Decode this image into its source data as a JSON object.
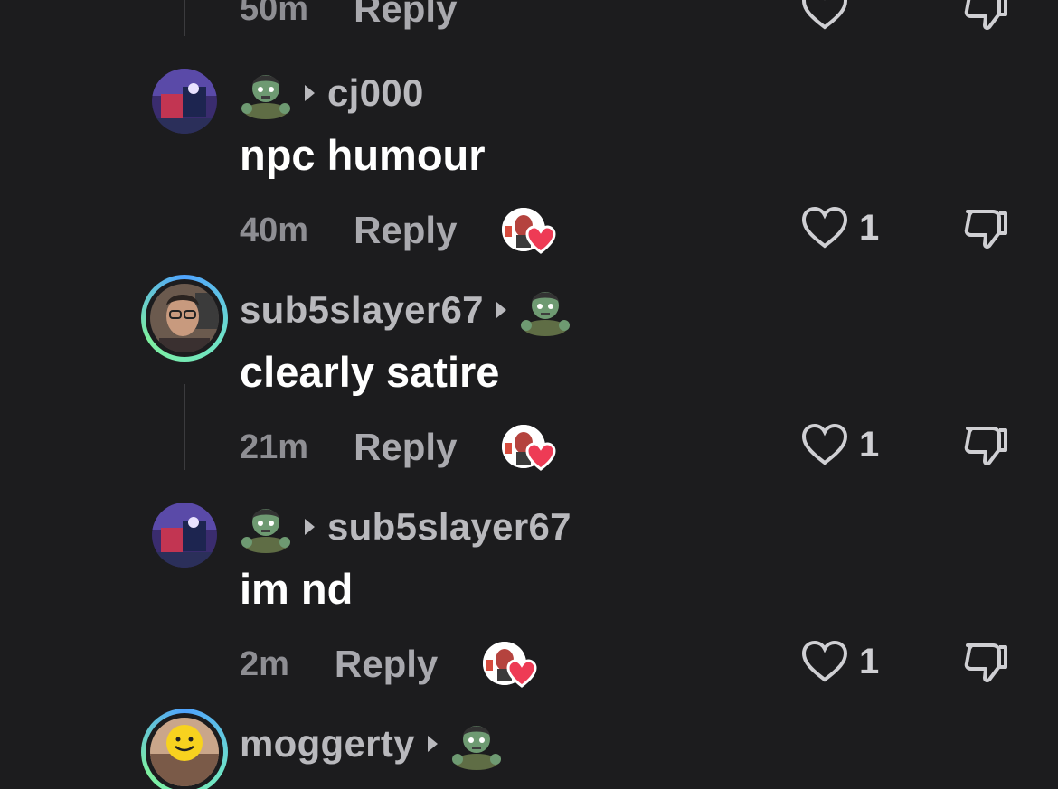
{
  "top": {
    "time": "50m",
    "reply": "Reply"
  },
  "comments": [
    {
      "username": "cj000",
      "reply_to": "cj000",
      "text": "npc humour",
      "time": "40m",
      "reply": "Reply",
      "likes": "1"
    },
    {
      "username": "sub5slayer67",
      "text": "clearly satire",
      "time": "21m",
      "reply": "Reply",
      "likes": "1"
    },
    {
      "reply_to": "sub5slayer67",
      "text": "im nd",
      "time": "2m",
      "reply": "Reply",
      "likes": "1"
    },
    {
      "username": "moggerty"
    }
  ],
  "colors": {
    "background": "#1c1c1e",
    "username": "#b9b9bd",
    "time": "#8e8e93",
    "heart_red": "#ee3b55"
  }
}
